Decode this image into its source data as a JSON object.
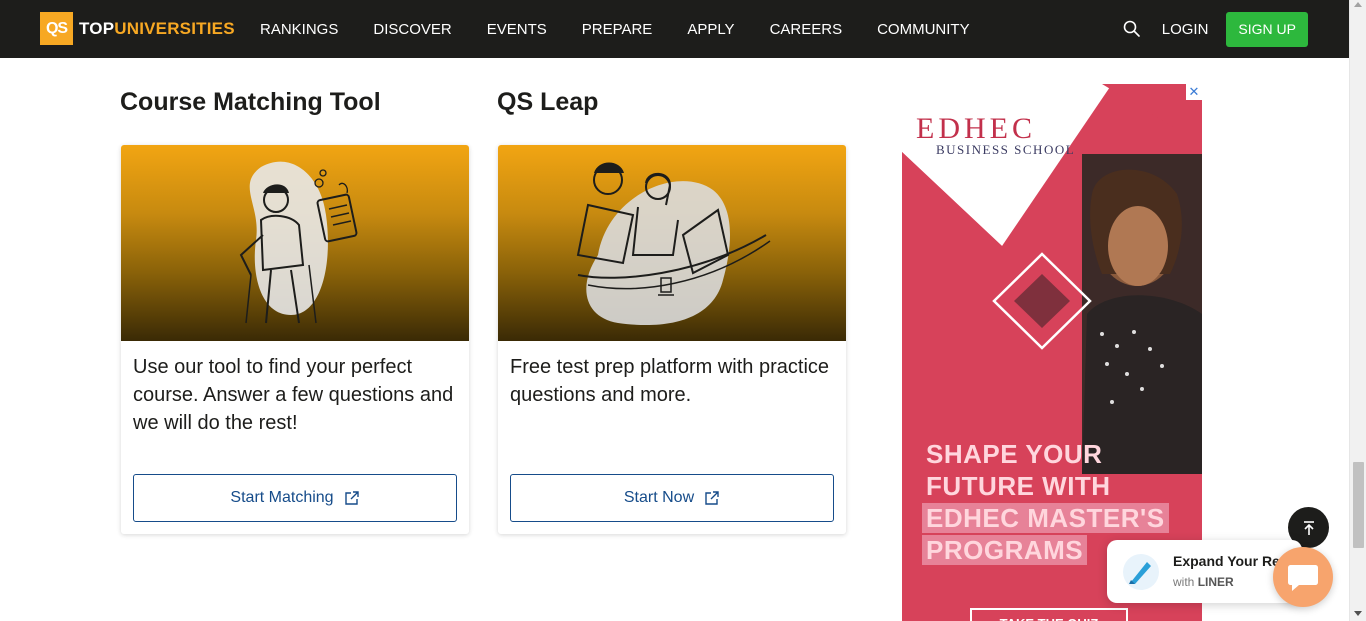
{
  "navbar": {
    "logo_mark": "QS",
    "logo_top": "TOP",
    "logo_universities": "UNIVERSITIES",
    "items": [
      "RANKINGS",
      "DISCOVER",
      "EVENTS",
      "PREPARE",
      "APPLY",
      "CAREERS",
      "COMMUNITY"
    ],
    "login": "LOGIN",
    "signup": "SIGN UP"
  },
  "sections": [
    {
      "title": "Course Matching Tool",
      "description": "Use our tool to find your perfect course. Answer a few questions and we will do the rest!",
      "button": "Start Matching"
    },
    {
      "title": "QS Leap",
      "description": "Free test prep platform with practice questions and more.",
      "button": "Start Now"
    }
  ],
  "ad": {
    "close": "✕",
    "brand": "EDHEC",
    "brand_sub": "BUSINESS SCHOOL",
    "headline": [
      "SHAPE YOUR",
      "FUTURE WITH",
      "EDHEC MASTER'S",
      "PROGRAMS"
    ],
    "cta": "TAKE THE QUIZ"
  },
  "liner": {
    "title": "Expand Your Re",
    "sub_prefix": "with",
    "sub_brand": "LINER"
  },
  "colors": {
    "nav_bg": "#1d1d1b",
    "brand_orange": "#f7a823",
    "signup_green": "#2db83d",
    "button_blue": "#164c8a",
    "ad_pink": "#d7425a"
  }
}
